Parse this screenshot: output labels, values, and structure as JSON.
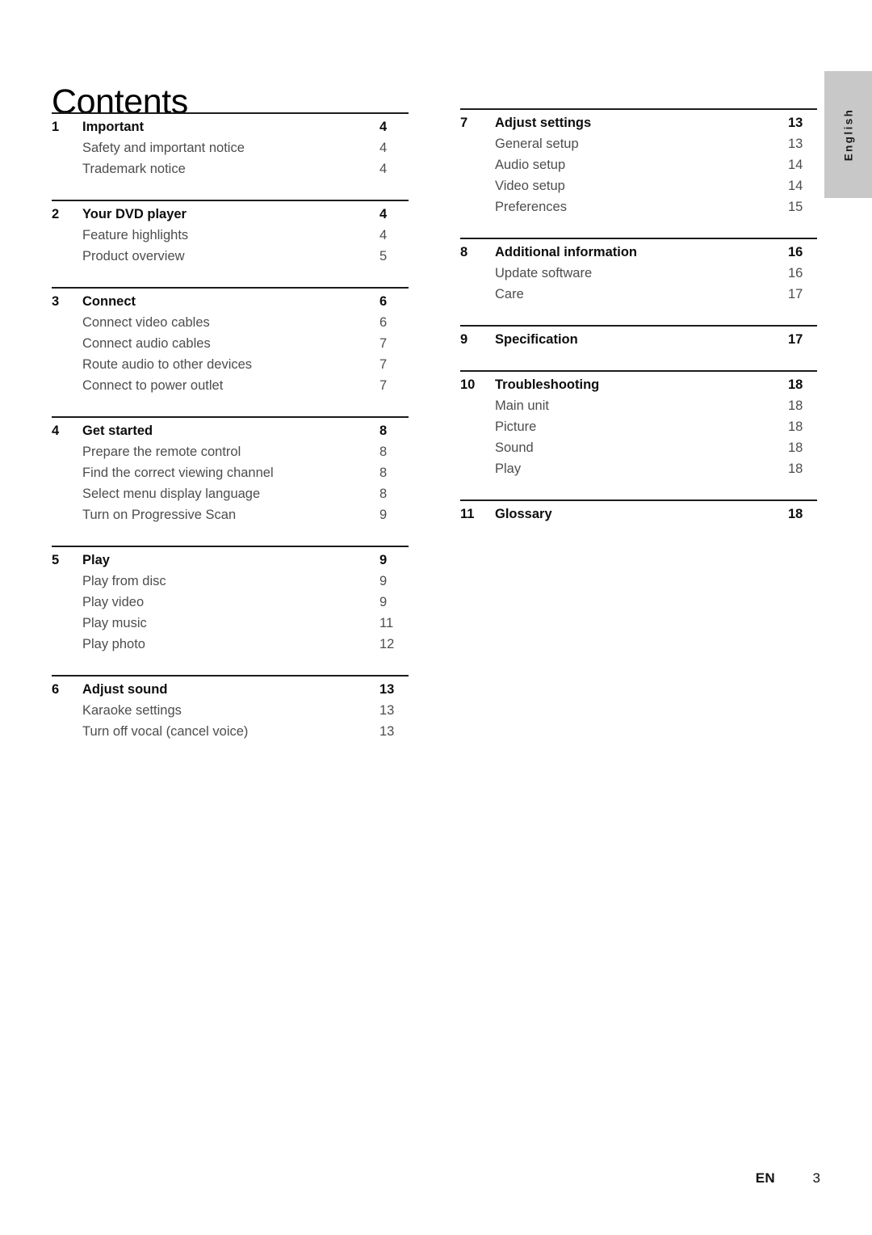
{
  "page_title": "Contents",
  "language_tab": "English",
  "footer": {
    "locale": "EN",
    "page_number": "3"
  },
  "columns": [
    {
      "id": "left",
      "groups": [
        {
          "heading": {
            "number": "1",
            "label": "Important",
            "page": "4"
          },
          "items": [
            {
              "label": "Safety and important notice",
              "page": "4"
            },
            {
              "label": "Trademark notice",
              "page": "4"
            }
          ]
        },
        {
          "heading": {
            "number": "2",
            "label": "Your DVD player",
            "page": "4"
          },
          "items": [
            {
              "label": "Feature highlights",
              "page": "4"
            },
            {
              "label": "Product overview",
              "page": "5"
            }
          ]
        },
        {
          "heading": {
            "number": "3",
            "label": "Connect",
            "page": "6"
          },
          "items": [
            {
              "label": "Connect video cables",
              "page": "6"
            },
            {
              "label": "Connect audio cables",
              "page": "7"
            },
            {
              "label": "Route audio to other devices",
              "page": "7"
            },
            {
              "label": "Connect to power outlet",
              "page": "7"
            }
          ]
        },
        {
          "heading": {
            "number": "4",
            "label": "Get started",
            "page": "8"
          },
          "items": [
            {
              "label": "Prepare the remote control",
              "page": "8"
            },
            {
              "label": "Find the correct viewing channel",
              "page": "8"
            },
            {
              "label": "Select menu display language",
              "page": "8"
            },
            {
              "label": "Turn on Progressive Scan",
              "page": "9"
            }
          ]
        },
        {
          "heading": {
            "number": "5",
            "label": "Play",
            "page": "9"
          },
          "items": [
            {
              "label": "Play from disc",
              "page": "9"
            },
            {
              "label": "Play video",
              "page": "9"
            },
            {
              "label": "Play music",
              "page": "11"
            },
            {
              "label": "Play photo",
              "page": "12"
            }
          ]
        },
        {
          "heading": {
            "number": "6",
            "label": "Adjust sound",
            "page": "13"
          },
          "items": [
            {
              "label": "Karaoke settings",
              "page": "13"
            },
            {
              "label": "Turn off vocal (cancel voice)",
              "page": "13"
            }
          ]
        }
      ]
    },
    {
      "id": "right",
      "groups": [
        {
          "heading": {
            "number": "7",
            "label": "Adjust settings",
            "page": "13"
          },
          "items": [
            {
              "label": "General setup",
              "page": "13"
            },
            {
              "label": "Audio setup",
              "page": "14"
            },
            {
              "label": "Video setup",
              "page": "14"
            },
            {
              "label": "Preferences",
              "page": "15"
            }
          ]
        },
        {
          "heading": {
            "number": "8",
            "label": "Additional information",
            "page": "16"
          },
          "items": [
            {
              "label": "Update software",
              "page": "16"
            },
            {
              "label": "Care",
              "page": "17"
            }
          ]
        },
        {
          "heading": {
            "number": "9",
            "label": "Specification",
            "page": "17"
          },
          "items": []
        },
        {
          "heading": {
            "number": "10",
            "label": "Troubleshooting",
            "page": "18"
          },
          "items": [
            {
              "label": "Main unit",
              "page": "18"
            },
            {
              "label": "Picture",
              "page": "18"
            },
            {
              "label": "Sound",
              "page": "18"
            },
            {
              "label": "Play",
              "page": "18"
            }
          ]
        },
        {
          "heading": {
            "number": "11",
            "label": "Glossary",
            "page": "18"
          },
          "items": []
        }
      ]
    }
  ]
}
